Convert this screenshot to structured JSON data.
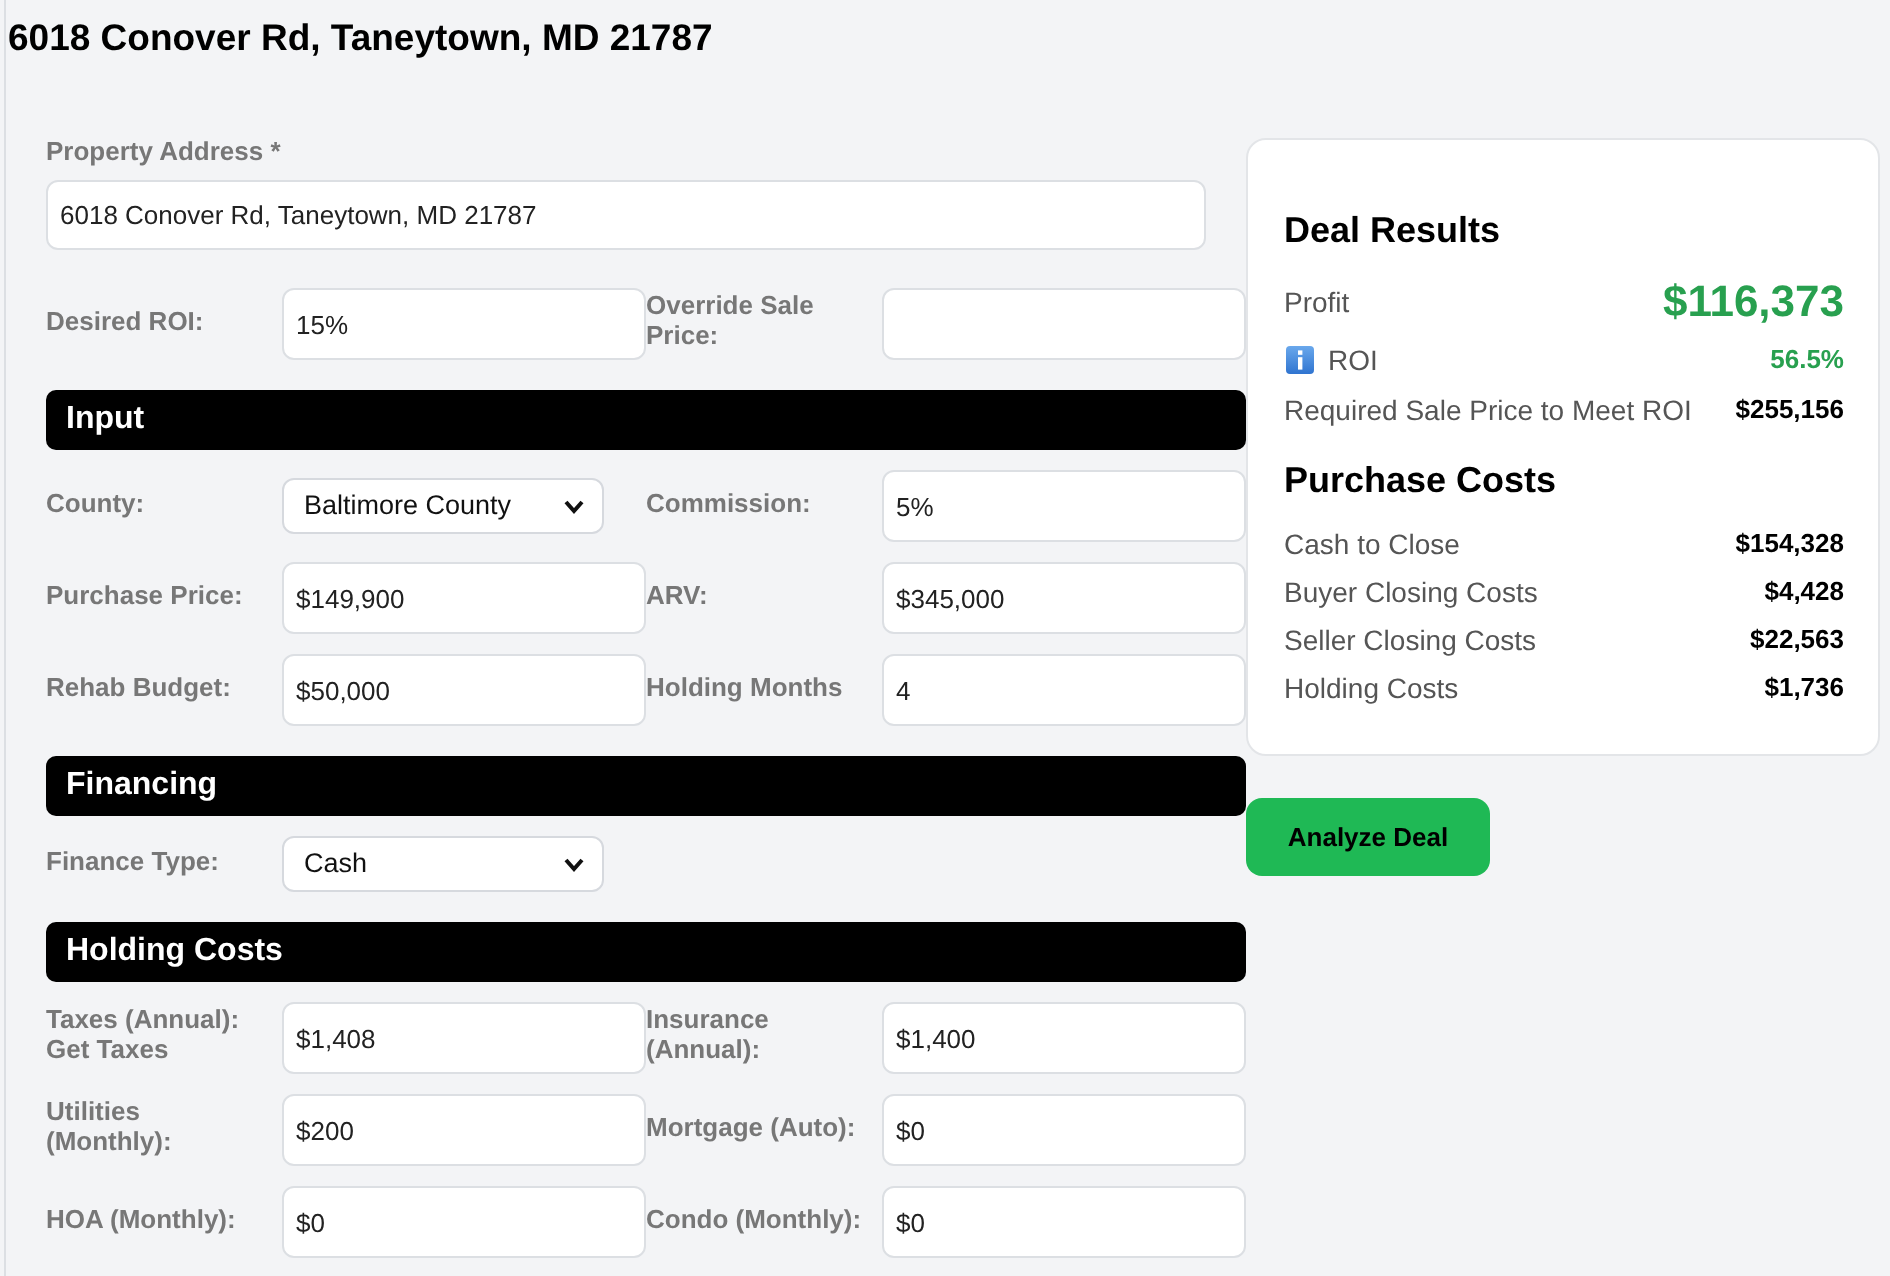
{
  "page_title": "6018 Conover Rd, Taneytown, MD 21787",
  "address": {
    "label": "Property Address *",
    "value": "6018 Conover Rd, Taneytown, MD 21787"
  },
  "top_fields": [
    {
      "kind": "input",
      "label": "Desired ROI:",
      "value": "15%"
    },
    {
      "kind": "input",
      "label": "Override Sale Price:"
    }
  ],
  "sections": [
    {
      "title": "Input",
      "fields": [
        {
          "kind": "select",
          "label": "County:",
          "value": "Baltimore County"
        },
        {
          "kind": "input",
          "label": "Commission:",
          "value": "5%"
        },
        {
          "kind": "input",
          "label": "Purchase Price:",
          "value": "$149,900"
        },
        {
          "kind": "input",
          "label": "ARV:",
          "value": "$345,000"
        },
        {
          "kind": "input",
          "label": "Rehab Budget:",
          "value": "$50,000"
        },
        {
          "kind": "input",
          "label": "Holding Months",
          "value": "4"
        }
      ]
    },
    {
      "title": "Financing",
      "fields": [
        {
          "kind": "select",
          "label": "Finance Type:",
          "value": "Cash"
        }
      ]
    },
    {
      "title": "Holding Costs",
      "fields": [
        {
          "kind": "input",
          "label": "Taxes (Annual):",
          "link": "Get Taxes",
          "value": "$1,408"
        },
        {
          "kind": "input",
          "label": "Insurance (Annual):",
          "value": "$1,400"
        },
        {
          "kind": "input",
          "label": "Utilities (Monthly):",
          "value": "$200"
        },
        {
          "kind": "input",
          "label": "Mortgage (Auto):",
          "value": "$0"
        },
        {
          "kind": "input",
          "label": "HOA (Monthly):",
          "value": "$0"
        },
        {
          "kind": "input",
          "label": "Condo (Monthly):",
          "value": "$0"
        }
      ]
    }
  ],
  "results": {
    "title": "Deal Results",
    "rows": [
      {
        "kind": "profit",
        "label": "Profit",
        "value": "$116,373"
      },
      {
        "kind": "roi",
        "label": "ROI",
        "value": "56.5%"
      },
      {
        "kind": "plain",
        "label": "Required Sale Price to Meet ROI",
        "value": "$255,156"
      }
    ]
  },
  "purchase_costs": {
    "title": "Purchase Costs",
    "rows": [
      {
        "label": "Cash to Close",
        "value": "$154,328"
      },
      {
        "label": "Buyer Closing Costs",
        "value": "$4,428"
      },
      {
        "label": "Seller Closing Costs",
        "value": "$22,563"
      },
      {
        "label": "Holding Costs",
        "value": "$1,736"
      }
    ]
  },
  "analyze_button": {
    "label": "Analyze Deal"
  }
}
